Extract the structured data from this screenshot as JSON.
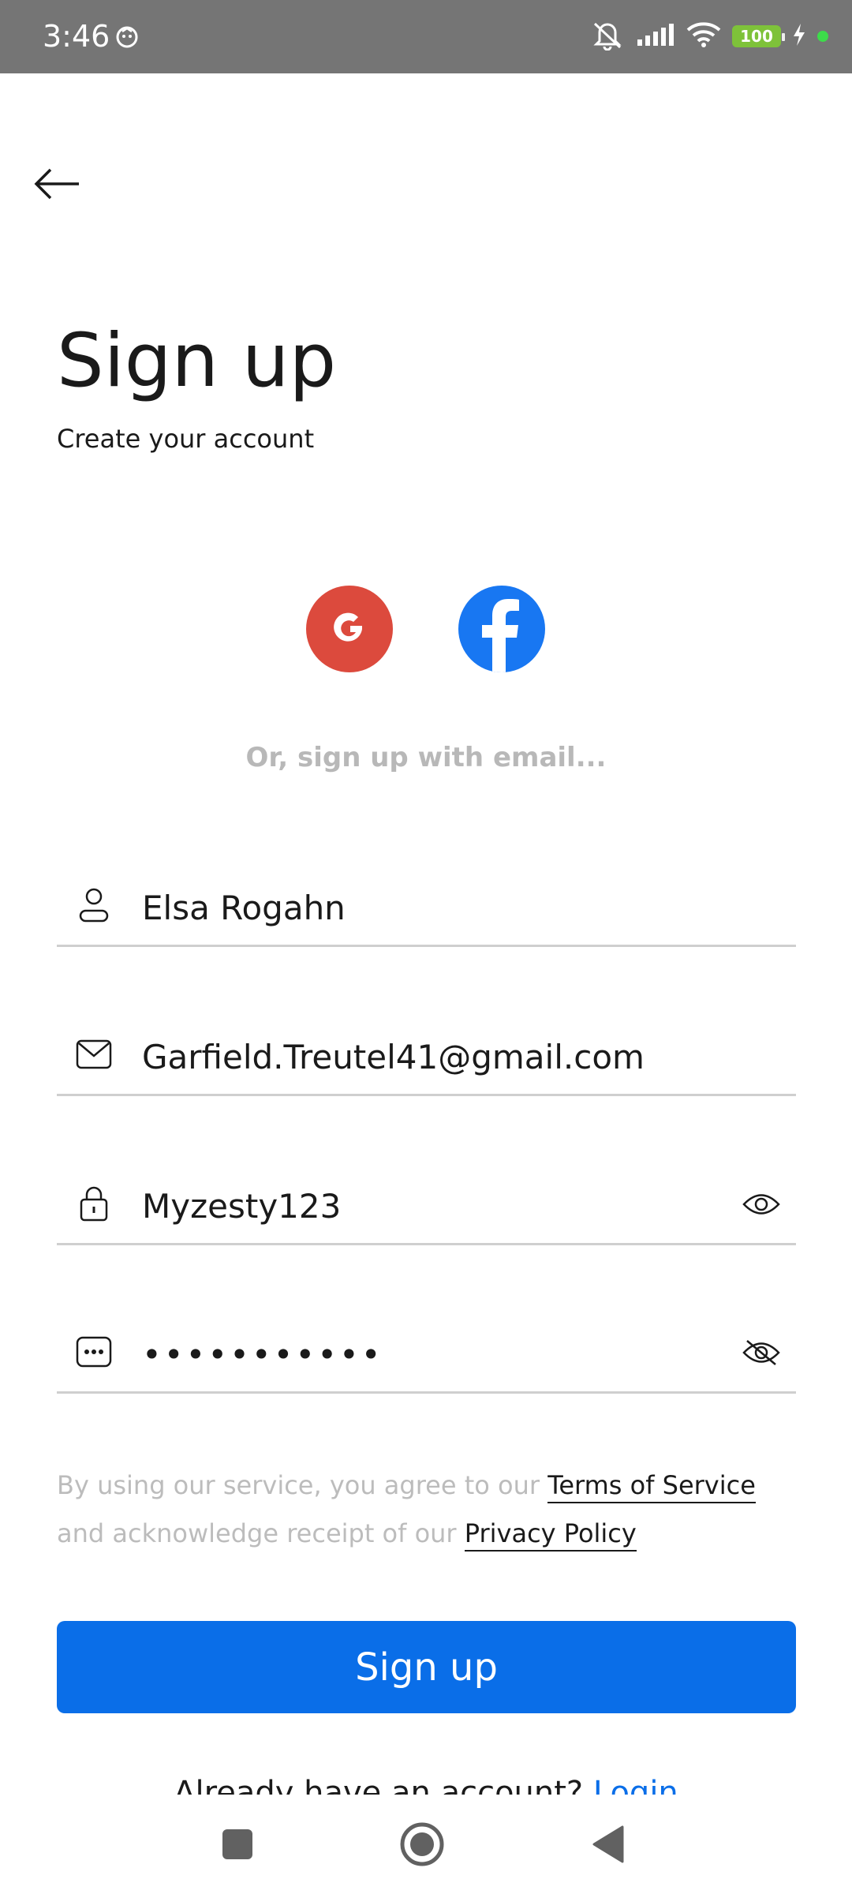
{
  "status_bar": {
    "time": "3:46",
    "battery": "100",
    "icons": [
      "notification-app-icon",
      "mute-icon",
      "signal-icon",
      "wifi-icon",
      "battery-icon",
      "charging-icon"
    ]
  },
  "header": {
    "title": "Sign up",
    "subtitle": "Create your account"
  },
  "social": {
    "google": "G",
    "facebook": "f"
  },
  "divider_text": "Or, sign up with email...",
  "form": {
    "name_value": "Elsa Rogahn",
    "email_value": "Garfield.Treutel41@gmail.com",
    "password_value": "Myzesty123",
    "confirm_password_masked": "•••••••••••"
  },
  "terms": {
    "text_before": "By using our service, you agree to our ",
    "terms_link": "Terms of Service",
    "text_middle": " and acknowledge receipt of our ",
    "privacy_link": "Privacy Policy"
  },
  "signup_button_label": "Sign up",
  "login_prompt": {
    "text": "Already have an account? ",
    "link": "Login"
  },
  "colors": {
    "primary": "#0a6ee8",
    "google": "#dc4a3d",
    "facebook": "#1877f2",
    "statusbar": "#757575"
  }
}
